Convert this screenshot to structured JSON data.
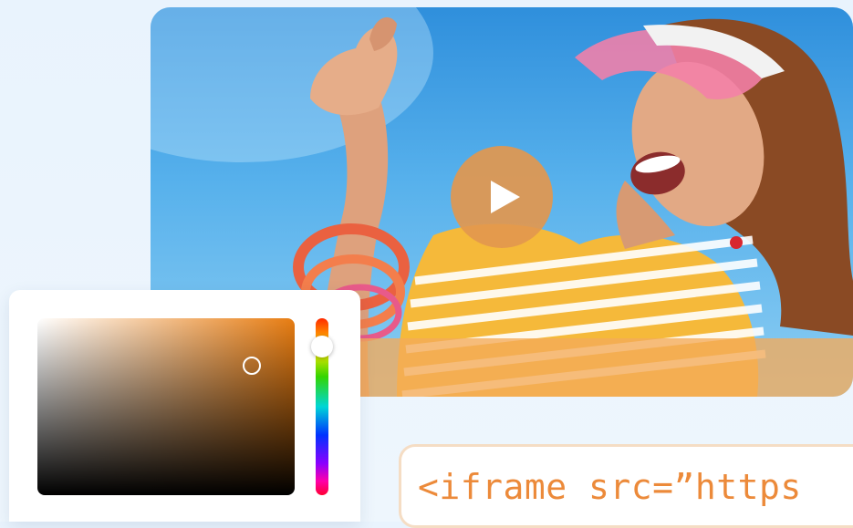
{
  "video": {
    "play_icon": "play-icon",
    "accent_color": "#e2974e"
  },
  "color_picker": {
    "selected_hue_color": "#e87d12"
  },
  "embed": {
    "code": "<iframe src=”https"
  }
}
